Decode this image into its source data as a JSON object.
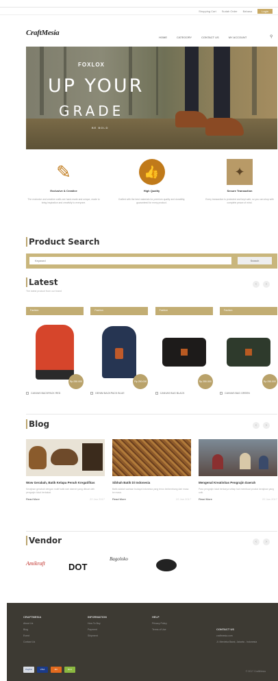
{
  "topbar": {
    "links": [
      "Shopping Cart",
      "Sudah Order",
      "Bahasa"
    ],
    "button": "Login"
  },
  "logo": "CraftMesia",
  "nav": [
    "HOME",
    "CATEGORY",
    "CONTACT US",
    "MY ACCOUNT"
  ],
  "hero": {
    "brand": "FOXLOX",
    "line1": "UP YOUR",
    "line2": "GRADE",
    "sub": "BE BOLD"
  },
  "features": [
    {
      "title": "Exclusive & Creative",
      "desc": "The exclusive and creative crafts are hand-made and unique, made to bring inspiration and creativity to everyone."
    },
    {
      "title": "High Quality",
      "desc": "Crafted with the best materials for premium quality and durability, guaranteed for every product."
    },
    {
      "title": "Secure Transaction",
      "desc": "Every transaction is protected and kept safe, so you can shop with complete peace of mind."
    }
  ],
  "search": {
    "title": "Product Search",
    "placeholder": "Keyword",
    "button": "Search"
  },
  "latest": {
    "title": "Latest",
    "subtitle": "The latest product from our brand",
    "products": [
      {
        "tag": "Fashion",
        "name": "CANVAS BACKPACK RED",
        "price": "Rp 250.000",
        "color": "#d6452b"
      },
      {
        "tag": "Fashion",
        "name": "DENIM BACKPACK BLUE",
        "price": "Rp 250.000",
        "color": "#263552"
      },
      {
        "tag": "Fashion",
        "name": "CANVAS BAG BLACK",
        "price": "Rp 250.000",
        "color": "#1d1b1a"
      },
      {
        "tag": "Fashion",
        "name": "CANVAS BAG GREEN",
        "price": "Rp 250.000",
        "color": "#2e3a2c"
      }
    ]
  },
  "blog": {
    "title": "Blog",
    "posts": [
      {
        "title": "Wow Gerabah, Batik Kelapa Penuh Kregatifitas",
        "desc": "Kerajinan gerabah dengan motif batik dari daerah yang dibuat oleh pengrajin lokal berbakat.",
        "more": "Read More",
        "date": "22 Jan 2017"
      },
      {
        "title": "Sibhah Batik Di Indonesia",
        "desc": "Batik adalah warisan budaya Indonesia yang terus berkembang dari masa ke masa.",
        "more": "Read More",
        "date": "22 Jan 2017"
      },
      {
        "title": "Mengenal Kreativitas Pengrajin Daerah",
        "desc": "Para pengrajin lokal berkarya setiap hari membuat produk kerajinan yang unik.",
        "more": "Read More",
        "date": "22 Jan 2017"
      }
    ]
  },
  "vendor": {
    "title": "Vendor",
    "logos": [
      "Amikraft",
      "DOT",
      "Bagoloko"
    ]
  },
  "footer": {
    "cols": [
      {
        "title": "CRAFTMESIA",
        "items": [
          "About Us",
          "Blog",
          "Event",
          "Contact Us"
        ]
      },
      {
        "title": "INFORMATION",
        "items": [
          "How To Buy",
          "Payment",
          "Shipment"
        ]
      },
      {
        "title": "HELP",
        "items": [
          "Privacy Policy",
          "Terms of Use"
        ]
      },
      {
        "title": "CONTACT US",
        "items": [
          "craftmesia.com",
          "Jl. Merdeka Barat, Jakarta - Indonesia"
        ]
      }
    ],
    "payments": [
      "PayPal",
      "VISA",
      "MC",
      "BCA"
    ],
    "copyright": "© 2017 CraftMesia"
  }
}
